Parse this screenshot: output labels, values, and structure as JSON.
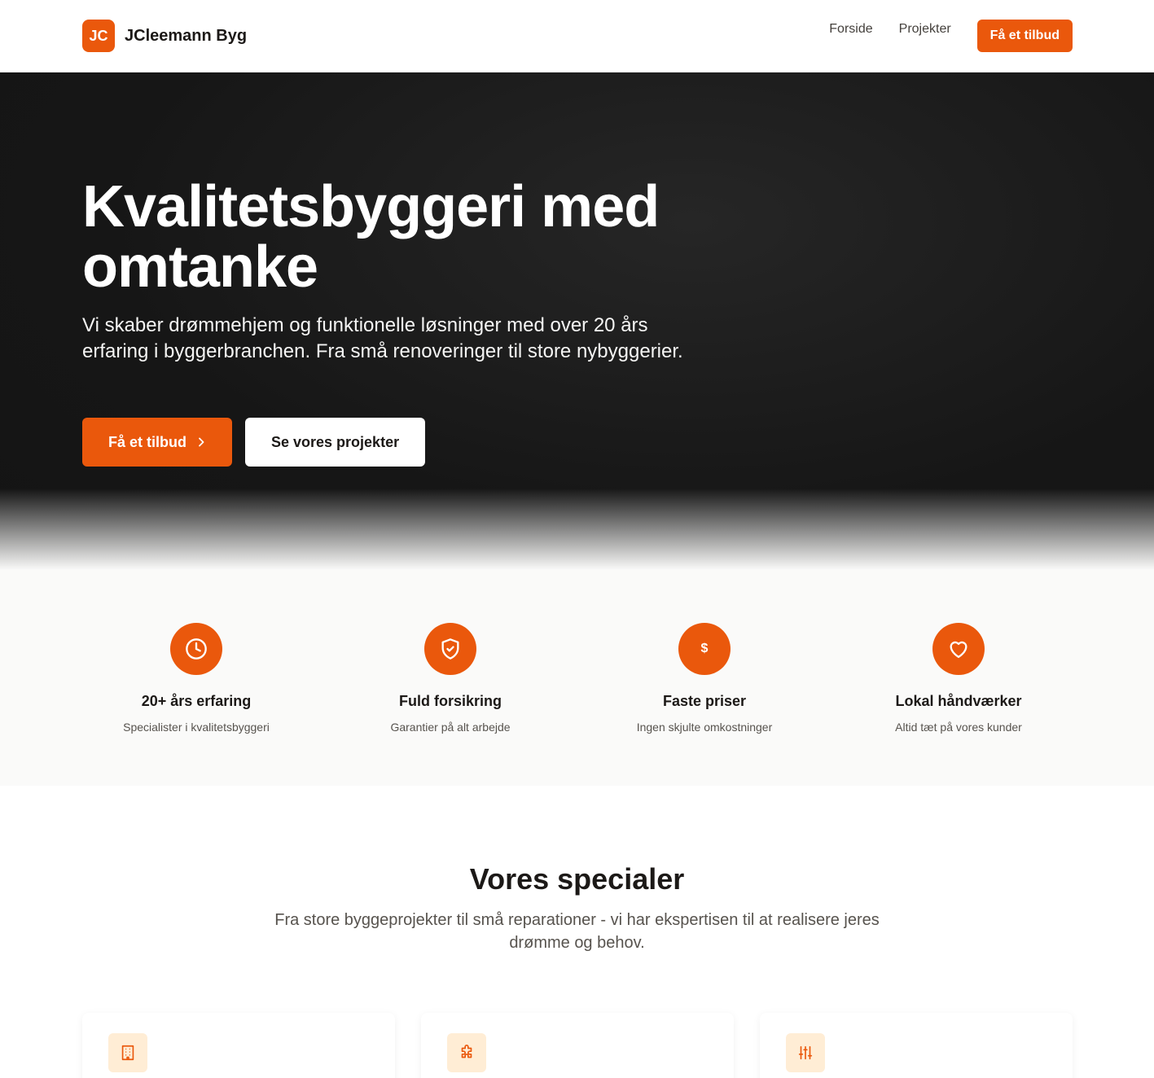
{
  "header": {
    "logo_badge": "JC",
    "brand_name": "JCleemann Byg",
    "nav": [
      "Forside",
      "Projekter"
    ],
    "cta_label": "Få et tilbud"
  },
  "hero": {
    "title": "Kvalitetsbyggeri med omtanke",
    "subtitle": "Vi skaber drømmehjem og funktionelle løsninger med over 20 års erfaring i byggerbranchen. Fra små renoveringer til store nybyggerier.",
    "primary_button": "Få et tilbud",
    "secondary_button": "Se vores projekter"
  },
  "features": [
    {
      "icon": "clock-icon",
      "title": "20+ års erfaring",
      "desc": "Specialister i kvalitetsbyggeri"
    },
    {
      "icon": "shield-check-icon",
      "title": "Fuld forsikring",
      "desc": "Garantier på alt arbejde"
    },
    {
      "icon": "dollar-icon",
      "title": "Faste priser",
      "desc": "Ingen skjulte omkostninger"
    },
    {
      "icon": "heart-icon",
      "title": "Lokal håndværker",
      "desc": "Altid tæt på vores kunder"
    }
  ],
  "specials": {
    "title": "Vores specialer",
    "subtitle": "Fra store byggeprojekter til små reparationer - vi har ekspertisen til at realisere jeres drømme og behov.",
    "cards": [
      {
        "icon": "building-icon"
      },
      {
        "icon": "puzzle-icon"
      },
      {
        "icon": "sliders-icon"
      }
    ]
  },
  "colors": {
    "accent": "#ea580c",
    "accent_light": "#ffedd5",
    "hero_bg": "#161616",
    "features_bg": "#fafaf9"
  }
}
